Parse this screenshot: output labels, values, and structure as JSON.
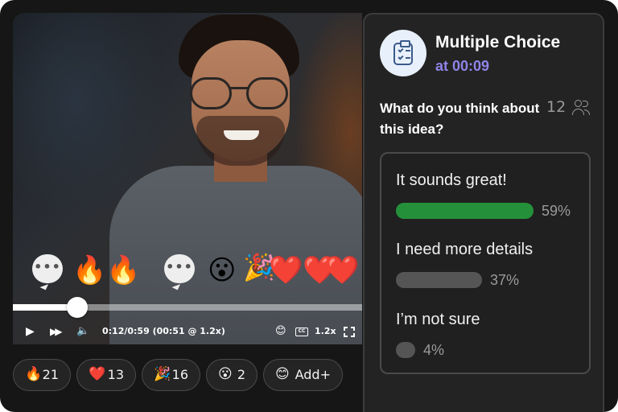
{
  "player": {
    "time_display": "0:12/0:59 (00:51 @ 1.2x)",
    "progress": 0.184,
    "speed": "1.2x",
    "cc_label": "CC"
  },
  "floating_reactions": [
    "💬",
    "🔥🔥",
    "💬",
    "😮",
    "🎉",
    "❤️❤️",
    "❤️"
  ],
  "reaction_chips": [
    {
      "emoji": "🔥",
      "count": "21"
    },
    {
      "emoji": "❤️",
      "count": "13"
    },
    {
      "emoji": "🎉",
      "count": "16"
    },
    {
      "emoji": "😮",
      "count": "2"
    },
    {
      "emoji": "😊",
      "count": "Add+"
    }
  ],
  "poll": {
    "title": "Multiple Choice",
    "timestamp": "at 00:09",
    "question": "What do you think about this idea?",
    "participants": "12",
    "options": [
      {
        "label": "It sounds great!",
        "percent": "59%",
        "value": 0.59,
        "color": "#24913a"
      },
      {
        "label": "I need more details",
        "percent": "37%",
        "value": 0.37,
        "color": "#555555"
      },
      {
        "label": "I’m not sure",
        "percent": "4%",
        "value": 0.04,
        "color": "#555555"
      }
    ]
  },
  "colors": {
    "accent_purple": "#8f84e8",
    "leading_green": "#24913a",
    "panel_bg": "#232323",
    "app_bg": "#161616"
  },
  "icons": {
    "poll": "clipboard-checklist-icon",
    "participants": "users-icon",
    "play": "play-icon",
    "skip": "fast-forward-icon",
    "volume": "volume-icon",
    "emoji": "emoji-icon",
    "cc": "captions-icon",
    "fullscreen": "fullscreen-icon"
  }
}
